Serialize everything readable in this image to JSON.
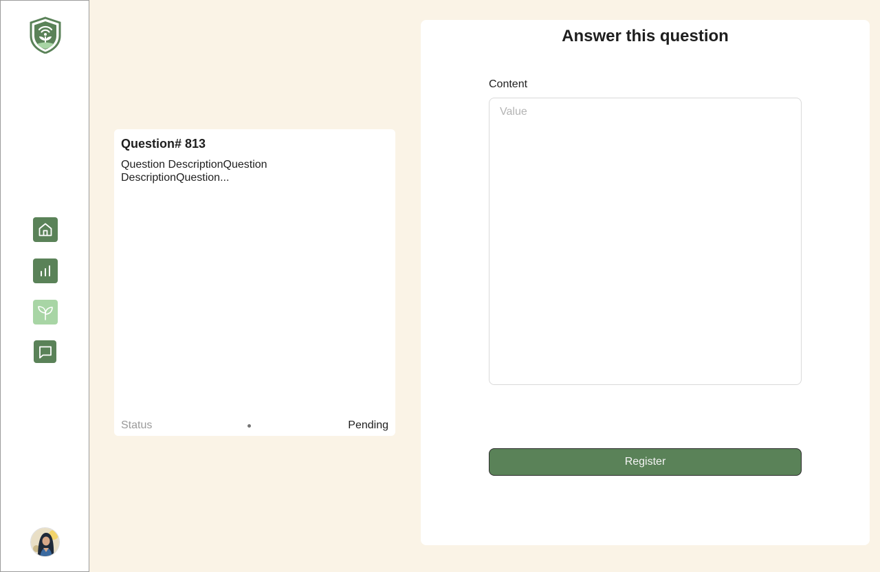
{
  "sidebar": {
    "logo_icon": "shield-plant-wifi-logo",
    "nav": [
      {
        "icon": "home-icon",
        "state": "default"
      },
      {
        "icon": "bar-chart-icon",
        "state": "default"
      },
      {
        "icon": "sprout-icon",
        "state": "active"
      },
      {
        "icon": "chat-bubble-icon",
        "state": "default"
      }
    ],
    "avatar_icon": "user-avatar"
  },
  "question_card": {
    "title": "Question# 813",
    "description": "Question DescriptionQuestion DescriptionQuestion...",
    "status_label": "Status",
    "status_value": "Pending"
  },
  "answer_form": {
    "title": "Answer this question",
    "content_label": "Content",
    "content_placeholder": "Value",
    "content_value": "",
    "submit_label": "Register"
  },
  "colors": {
    "background": "#faf3e6",
    "primary_green": "#5a8258",
    "light_green": "#a8d5a5",
    "card": "#ffffff"
  }
}
